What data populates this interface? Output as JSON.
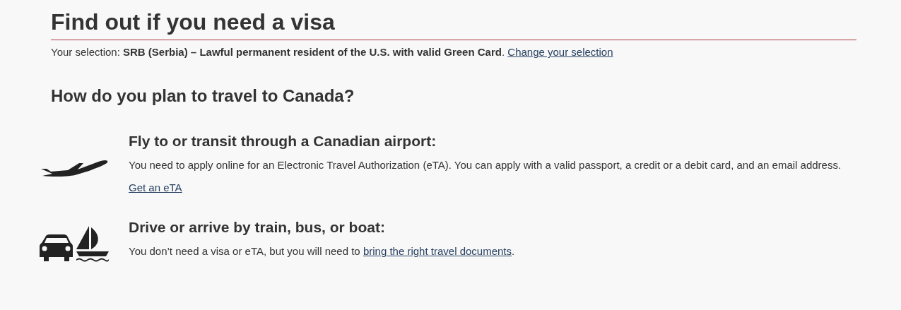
{
  "title": "Find out if you need a visa",
  "selection": {
    "label": "Your selection:",
    "value": "SRB (Serbia) – Lawful permanent resident of the U.S. with valid Green Card",
    "after": ".",
    "link": "Change your selection"
  },
  "question": "How do you plan to travel to Canada?",
  "options": [
    {
      "kind": "fly",
      "heading": "Fly to or transit through a Canadian airport:",
      "body": [
        {
          "kind": "text",
          "text": "You need to apply online for an Electronic Travel Authorization (eTA). You can apply with a valid passport, a credit or a debit card, and an email address."
        }
      ],
      "link": "Get an eTA"
    },
    {
      "kind": "drive",
      "heading": "Drive or arrive by train, bus, or boat:",
      "body": [
        {
          "kind": "text",
          "text": "You don’t need a visa or eTA, but you will need to "
        },
        {
          "kind": "link",
          "text": "bring the right travel documents"
        },
        {
          "kind": "text",
          "text": "."
        }
      ]
    }
  ]
}
